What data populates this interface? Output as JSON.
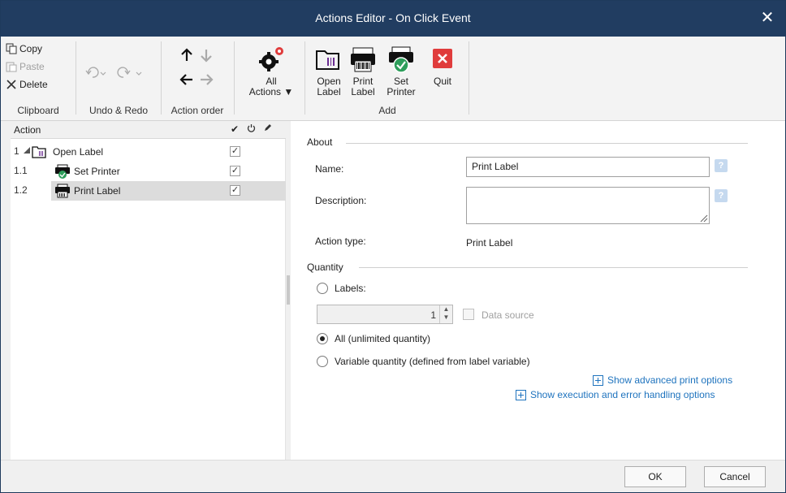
{
  "window": {
    "title": "Actions Editor - On Click Event",
    "close_glyph": "✕"
  },
  "ribbon": {
    "clipboard": {
      "copy": "Copy",
      "paste": "Paste",
      "delete": "Delete",
      "group_label": "Clipboard"
    },
    "undo_redo": {
      "group_label": "Undo & Redo"
    },
    "action_order": {
      "group_label": "Action order"
    },
    "all_actions": {
      "line1": "All",
      "line2": "Actions"
    },
    "add": {
      "open_label": [
        "Open",
        "Label"
      ],
      "print_label": [
        "Print",
        "Label"
      ],
      "set_printer": [
        "Set",
        "Printer"
      ],
      "quit": "Quit",
      "group_label": "Add"
    }
  },
  "tree": {
    "header": "Action",
    "rows": [
      {
        "num": "1",
        "label": "Open Label",
        "checked": true,
        "icon": "open-label-icon"
      },
      {
        "num": "1.1",
        "label": "Set Printer",
        "checked": true,
        "icon": "set-printer-icon"
      },
      {
        "num": "1.2",
        "label": "Print Label",
        "checked": true,
        "icon": "print-label-icon",
        "selected": true
      }
    ]
  },
  "props": {
    "about": {
      "title": "About",
      "name_label": "Name:",
      "name_value": "Print Label",
      "description_label": "Description:",
      "description_value": "",
      "action_type_label": "Action type:",
      "action_type_value": "Print Label"
    },
    "quantity": {
      "title": "Quantity",
      "labels_option": "Labels:",
      "labels_value": "1",
      "data_source": "Data source",
      "all_option": "All (unlimited quantity)",
      "variable_option": "Variable quantity (defined from label variable)",
      "selected": "all"
    },
    "links": {
      "advanced": "Show advanced print options",
      "execution": "Show execution and error handling options"
    }
  },
  "footer": {
    "ok": "OK",
    "cancel": "Cancel"
  },
  "colors": {
    "titlebar": "#213d61",
    "link": "#1e73be",
    "quit_red": "#e03c3c",
    "green": "#2e9e5b"
  }
}
